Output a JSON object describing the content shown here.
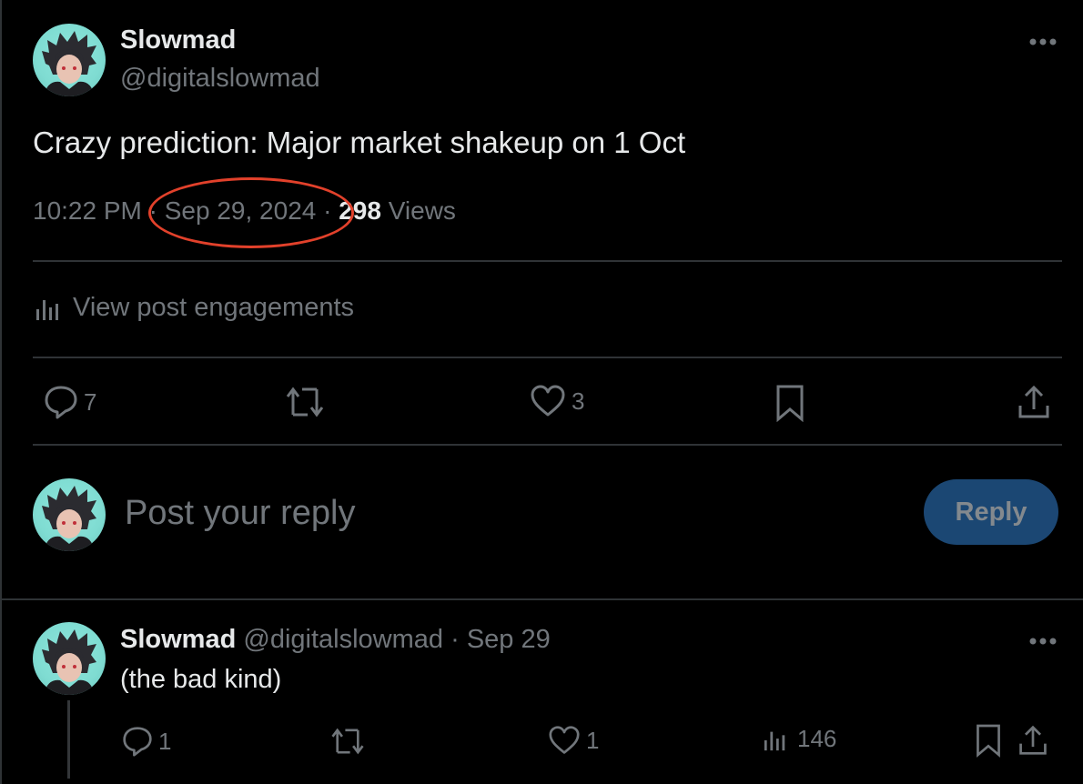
{
  "post": {
    "author_name": "Slowmad",
    "author_handle": "@digitalslowmad",
    "text": "Crazy prediction: Major market shakeup on 1 Oct",
    "time": "10:22 PM",
    "separator": "·",
    "date": "Sep 29, 2024",
    "views_count": "298",
    "views_label": "Views",
    "engagements_label": "View post engagements",
    "more_icon": "more-horizontal-icon",
    "actions": {
      "reply_count": "7",
      "repost_count": "",
      "like_count": "3"
    }
  },
  "reply_box": {
    "placeholder": "Post your reply",
    "button_label": "Reply"
  },
  "reply_post": {
    "author_name": "Slowmad",
    "author_handle": "@digitalslowmad",
    "separator": "·",
    "date": "Sep 29",
    "text": "(the bad kind)",
    "actions": {
      "reply_count": "1",
      "repost_count": "",
      "like_count": "1",
      "views_count": "146"
    }
  },
  "annotation": {
    "highlight_color": "#e2412b",
    "highlighted_text": "Sep 29, 2024"
  },
  "colors": {
    "background": "#000000",
    "text_primary": "#e7e9ea",
    "text_muted": "#71767b",
    "divider": "#2f3336",
    "reply_button_bg": "#1d4b7a"
  }
}
